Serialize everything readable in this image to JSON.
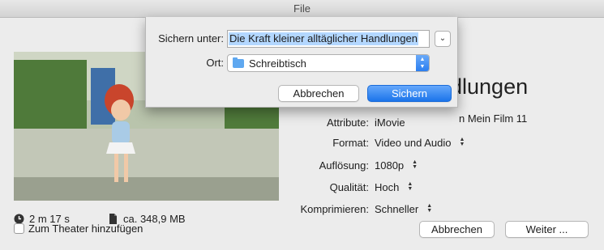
{
  "window": {
    "title": "File"
  },
  "background_panel": {
    "title_fragment": "dlungen",
    "subtitle_fragment": "n Mein Film 11",
    "duration": "2 m 17 s",
    "size": "ca. 348,9 MB",
    "properties": [
      {
        "label": "Attribute:",
        "value": "iMovie",
        "stepper": false
      },
      {
        "label": "Format:",
        "value": "Video und Audio",
        "stepper": true
      },
      {
        "label": "Auflösung:",
        "value": "1080p",
        "stepper": true
      },
      {
        "label": "Qualität:",
        "value": "Hoch",
        "stepper": true
      },
      {
        "label": "Komprimieren:",
        "value": "Schneller",
        "stepper": true
      }
    ],
    "add_to_theater_label": "Zum Theater hinzufügen",
    "cancel_label": "Abbrechen",
    "next_label": "Weiter ..."
  },
  "save_sheet": {
    "save_as_label": "Sichern unter:",
    "filename": "Die Kraft kleiner alltäglicher Handlungen",
    "location_label": "Ort:",
    "location_value": "Schreibtisch",
    "cancel_label": "Abbrechen",
    "save_label": "Sichern"
  },
  "colors": {
    "accent": "#1b74ea",
    "selection": "#b3d7ff",
    "folder": "#5fa8f0"
  }
}
